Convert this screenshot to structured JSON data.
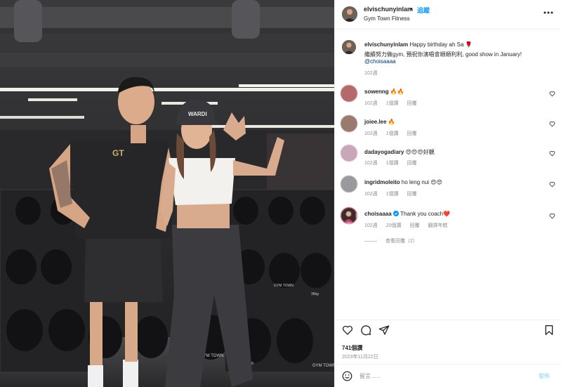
{
  "header": {
    "username": "elvischunyinlam",
    "separator": "•",
    "follow_label": "追蹤",
    "location": "Gym Town Fitness"
  },
  "caption": {
    "username": "elvischunyinlam",
    "line1": "Happy birthday ah Sa",
    "line1_emoji": "🌹",
    "line2": "繼續努力做gym, 預祝你演唱會順順利利, good show in January!",
    "mention": "@choisaaaa",
    "time": "102週"
  },
  "comments": [
    {
      "username": "sowenng",
      "text": "🔥🔥",
      "time": "102週",
      "likes": "1個讚",
      "reply": "回覆",
      "avatar_color": "#b46a6a"
    },
    {
      "username": "joiee.lee",
      "text": "🔥",
      "time": "102週",
      "likes": "1個讚",
      "reply": "回覆",
      "avatar_color": "#9a7a6e"
    },
    {
      "username": "dadayogadiary",
      "text": "😍😍😍好靚",
      "time": "102週",
      "likes": "1個讚",
      "reply": "回覆",
      "avatar_color": "#c9a6b8"
    },
    {
      "username": "ingridmoleito",
      "text": "ho leng nui 😍😍",
      "time": "102週",
      "likes": "1個讚",
      "reply": "回覆",
      "avatar_color": "#9a9a9e"
    },
    {
      "username": "choisaaaa",
      "text": "Thank you coach❤️",
      "time": "102週",
      "likes": "20個讚",
      "reply": "回覆",
      "translate": "翻譯年糕",
      "avatar_color": "#c9476b",
      "verified": true
    }
  ],
  "view_replies": "查看回覆（2）",
  "actions": {
    "icons": [
      "heart-icon",
      "comment-icon",
      "share-icon",
      "bookmark-icon"
    ],
    "likes": "741個讚",
    "date": "2023年11月22日"
  },
  "add_comment": {
    "placeholder": "留言......",
    "post_label": "發佈"
  },
  "photo": {
    "cap_text": "WARDI",
    "plate_label": "GYM TOWN",
    "plate_weight": "36kg"
  },
  "colors": {
    "accent": "#0095f6",
    "verified": "#0095f6",
    "muted": "#8e8e8e",
    "post_disabled": "#b2dffc"
  }
}
